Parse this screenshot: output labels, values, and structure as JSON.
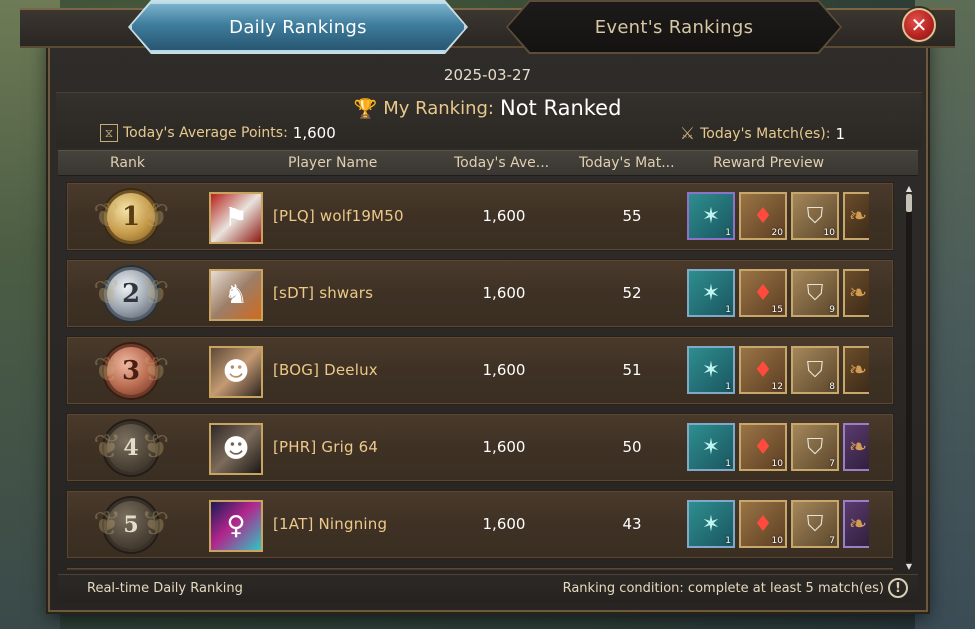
{
  "tabs": [
    {
      "label": "Daily Rankings",
      "active": true
    },
    {
      "label": "Event's Rankings",
      "active": false
    }
  ],
  "date": "2025-03-27",
  "my_ranking": {
    "label": "My Ranking:",
    "value": "Not Ranked"
  },
  "summary": {
    "avg_points_label": "Today's Average Points:",
    "avg_points_value": "1,600",
    "matches_label": "Today's Match(es):",
    "matches_value": "1"
  },
  "columns": {
    "rank": "Rank",
    "player": "Player Name",
    "avg": "Today's Ave...",
    "matches": "Today's Mat...",
    "reward": "Reward Preview"
  },
  "rows": [
    {
      "rank": "1",
      "player": "[PLQ] wolf19M50",
      "avg": "1,600",
      "matches": "55",
      "rewards": [
        "1",
        "20",
        "10"
      ]
    },
    {
      "rank": "2",
      "player": "[sDT] shwars",
      "avg": "1,600",
      "matches": "52",
      "rewards": [
        "1",
        "15",
        "9"
      ]
    },
    {
      "rank": "3",
      "player": "[BOG] Deelux",
      "avg": "1,600",
      "matches": "51",
      "rewards": [
        "1",
        "12",
        "8"
      ]
    },
    {
      "rank": "4",
      "player": "[PHR] Grig 64",
      "avg": "1,600",
      "matches": "50",
      "rewards": [
        "1",
        "10",
        "7"
      ]
    },
    {
      "rank": "5",
      "player": "[1AT] Ningning",
      "avg": "1,600",
      "matches": "43",
      "rewards": [
        "1",
        "10",
        "7"
      ]
    }
  ],
  "footer": {
    "left": "Real-time Daily Ranking",
    "right": "Ranking condition: complete at least 5 match(es)"
  },
  "icons": {
    "close": "close-icon",
    "trophy": "trophy-icon",
    "hourglass": "hourglass-icon",
    "sword": "sword-icon",
    "info": "info-icon"
  },
  "colors": {
    "active_tab": "#3f7d9d",
    "gold_text": "#ecc98a",
    "close_button": "#b4221f"
  }
}
